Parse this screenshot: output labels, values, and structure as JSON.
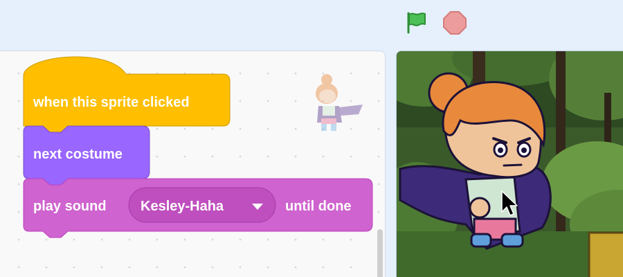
{
  "toolbar": {
    "green_flag_icon": "green-flag-icon",
    "stop_icon": "stop-sign-icon"
  },
  "blocks": {
    "hat": {
      "label": "when this sprite clicked",
      "color": "#ffbf00"
    },
    "next_costume": {
      "label": "next costume",
      "color": "#9966ff"
    },
    "play_sound": {
      "label_before": "play sound",
      "sound": "Kesley-Haha",
      "label_after": "until done",
      "color": "#cf63cf"
    }
  },
  "colors": {
    "events": "#ffbf00",
    "looks": "#9966ff",
    "sound": "#cf63cf",
    "flag": "#4cbf56",
    "stop": "#ec9c9c"
  }
}
